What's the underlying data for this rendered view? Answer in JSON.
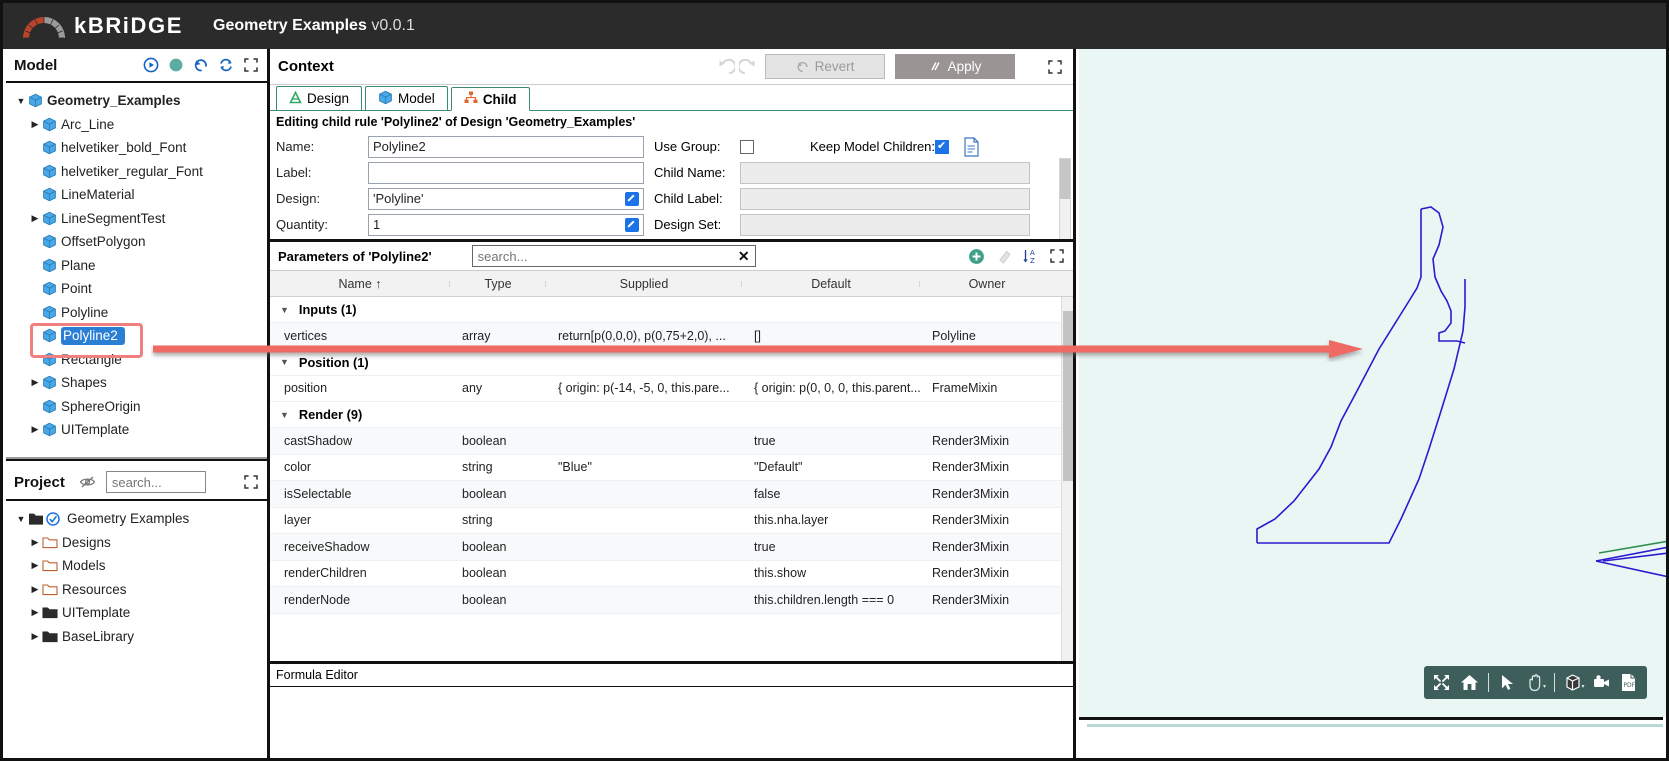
{
  "titlebar": {
    "brand": "kBRiDGE",
    "app_title": "Geometry Examples",
    "version": "v0.0.1",
    "logo_icon": "bridge-arc-icon"
  },
  "model_panel": {
    "title": "Model",
    "icons": [
      "play-circle-icon",
      "record-dot-icon",
      "history-revert-icon",
      "refresh-icon",
      "expand-icon"
    ],
    "tree": [
      {
        "label": "Geometry_Examples",
        "depth": 0,
        "twisty": "down",
        "icon": "cube-icon",
        "selected": false,
        "bold": true
      },
      {
        "label": "Arc_Line",
        "depth": 1,
        "twisty": "right",
        "icon": "cube-icon",
        "selected": false
      },
      {
        "label": "helvetiker_bold_Font",
        "depth": 1,
        "twisty": "none",
        "icon": "cube-icon",
        "selected": false
      },
      {
        "label": "helvetiker_regular_Font",
        "depth": 1,
        "twisty": "none",
        "icon": "cube-icon",
        "selected": false
      },
      {
        "label": "LineMaterial",
        "depth": 1,
        "twisty": "none",
        "icon": "cube-icon",
        "selected": false
      },
      {
        "label": "LineSegmentTest",
        "depth": 1,
        "twisty": "right",
        "icon": "cube-icon",
        "selected": false
      },
      {
        "label": "OffsetPolygon",
        "depth": 1,
        "twisty": "none",
        "icon": "cube-icon",
        "selected": false
      },
      {
        "label": "Plane",
        "depth": 1,
        "twisty": "none",
        "icon": "cube-icon",
        "selected": false
      },
      {
        "label": "Point",
        "depth": 1,
        "twisty": "none",
        "icon": "cube-icon",
        "selected": false
      },
      {
        "label": "Polyline",
        "depth": 1,
        "twisty": "none",
        "icon": "cube-icon",
        "selected": false
      },
      {
        "label": "Polyline2",
        "depth": 1,
        "twisty": "none",
        "icon": "cube-icon",
        "selected": true
      },
      {
        "label": "Rectangle",
        "depth": 1,
        "twisty": "none",
        "icon": "cube-icon",
        "selected": false
      },
      {
        "label": "Shapes",
        "depth": 1,
        "twisty": "right",
        "icon": "cube-icon",
        "selected": false
      },
      {
        "label": "SphereOrigin",
        "depth": 1,
        "twisty": "none",
        "icon": "cube-icon",
        "selected": false
      },
      {
        "label": "UITemplate",
        "depth": 1,
        "twisty": "right",
        "icon": "cube-icon",
        "selected": false
      }
    ]
  },
  "project_panel": {
    "title": "Project",
    "eye_icon": "eye-slash-icon",
    "search_placeholder": "search...",
    "search_value": "",
    "expand_icon": "expand-icon",
    "tree": [
      {
        "label": "Geometry Examples",
        "depth": 0,
        "twisty": "down",
        "icon": "open-folder-check-icon"
      },
      {
        "label": "Designs",
        "depth": 1,
        "twisty": "right",
        "icon": "folder-icon"
      },
      {
        "label": "Models",
        "depth": 1,
        "twisty": "right",
        "icon": "folder-icon"
      },
      {
        "label": "Resources",
        "depth": 1,
        "twisty": "right",
        "icon": "folder-icon"
      },
      {
        "label": "UITemplate",
        "depth": 1,
        "twisty": "right",
        "icon": "folder-filled-icon"
      },
      {
        "label": "BaseLibrary",
        "depth": 1,
        "twisty": "right",
        "icon": "folder-filled-icon"
      }
    ]
  },
  "context": {
    "title": "Context",
    "undo_icon": "undo-icon",
    "redo_icon": "redo-icon",
    "revert_label": "Revert",
    "apply_label": "Apply",
    "expand_icon": "expand-icon",
    "tabs": [
      {
        "label": "Design",
        "icon": "design-a-icon",
        "active": false
      },
      {
        "label": "Model",
        "icon": "cube-icon",
        "active": false
      },
      {
        "label": "Child",
        "icon": "hierarchy-icon",
        "active": true
      }
    ],
    "edit_note": "Editing child rule 'Polyline2' of Design 'Geometry_Examples'",
    "fields": {
      "name_label": "Name:",
      "name_value": "Polyline2",
      "label_label": "Label:",
      "label_value": "",
      "design_label": "Design:",
      "design_value": "'Polyline'",
      "quantity_label": "Quantity:",
      "quantity_value": "1",
      "use_group_label": "Use Group:",
      "use_group_checked": false,
      "keep_model_children_label": "Keep Model Children:",
      "keep_model_children_checked": true,
      "child_name_label": "Child Name:",
      "child_name_value": "",
      "child_label_label": "Child Label:",
      "child_label_value": "",
      "design_set_label": "Design Set:",
      "design_set_value": "",
      "doc_icon": "document-icon"
    }
  },
  "parameters": {
    "title": "Parameters of 'Polyline2'",
    "search_placeholder": "search...",
    "search_value": "",
    "clear_icon": "x-clear-icon",
    "add_icon": "add-circle-icon",
    "eraser_icon": "eraser-icon",
    "sort_icon": "sort-az-icon",
    "expand_icon": "expand-icon",
    "columns": [
      "Name ↑",
      "Type",
      "Supplied",
      "Default",
      "Owner"
    ],
    "groups": [
      {
        "title": "Inputs (1)",
        "rows": [
          {
            "name": "vertices",
            "type": "array",
            "supplied": "return[p(0,0,0), p(0,75+2,0), ...",
            "default": "[]",
            "owner": "Polyline"
          }
        ]
      },
      {
        "title": "Position (1)",
        "rows": [
          {
            "name": "position",
            "type": "any",
            "supplied": "{ origin: p(-14, -5, 0, this.pare...",
            "default": "{ origin: p(0, 0, 0, this.parent....",
            "owner": "FrameMixin"
          }
        ]
      },
      {
        "title": "Render (9)",
        "rows": [
          {
            "name": "castShadow",
            "type": "boolean",
            "supplied": "",
            "default": "true",
            "owner": "Render3Mixin"
          },
          {
            "name": "color",
            "type": "string",
            "supplied": "\"Blue\"",
            "default": "\"Default\"",
            "owner": "Render3Mixin"
          },
          {
            "name": "isSelectable",
            "type": "boolean",
            "supplied": "",
            "default": "false",
            "owner": "Render3Mixin"
          },
          {
            "name": "layer",
            "type": "string",
            "supplied": "",
            "default": "this.nha.layer",
            "owner": "Render3Mixin"
          },
          {
            "name": "receiveShadow",
            "type": "boolean",
            "supplied": "",
            "default": "true",
            "owner": "Render3Mixin"
          },
          {
            "name": "renderChildren",
            "type": "boolean",
            "supplied": "",
            "default": "this.show",
            "owner": "Render3Mixin"
          },
          {
            "name": "renderNode",
            "type": "boolean",
            "supplied": "",
            "default": "this.children.length === 0",
            "owner": "Render3Mixin"
          }
        ]
      }
    ]
  },
  "formula_editor": {
    "title": "Formula Editor"
  },
  "viewport": {
    "background_color": "#e9f6f4",
    "shape_color": "#2b1ad0",
    "accent_green": "#2f8f4e",
    "toolbar": [
      {
        "icon": "fit-to-screen-icon",
        "has_caret": false
      },
      {
        "icon": "home-icon",
        "has_caret": false
      },
      {
        "icon": "separator",
        "has_caret": false
      },
      {
        "icon": "cursor-arrow-icon",
        "has_caret": false
      },
      {
        "icon": "pan-hand-icon",
        "has_caret": true
      },
      {
        "icon": "separator",
        "has_caret": false
      },
      {
        "icon": "cube-view-icon",
        "has_caret": true
      },
      {
        "icon": "camera-icon",
        "has_caret": false
      },
      {
        "icon": "pdf-export-icon",
        "has_caret": false
      }
    ]
  },
  "annotation": {
    "arrow_color": "#ee6a64",
    "highlight_color": "#f08080"
  }
}
